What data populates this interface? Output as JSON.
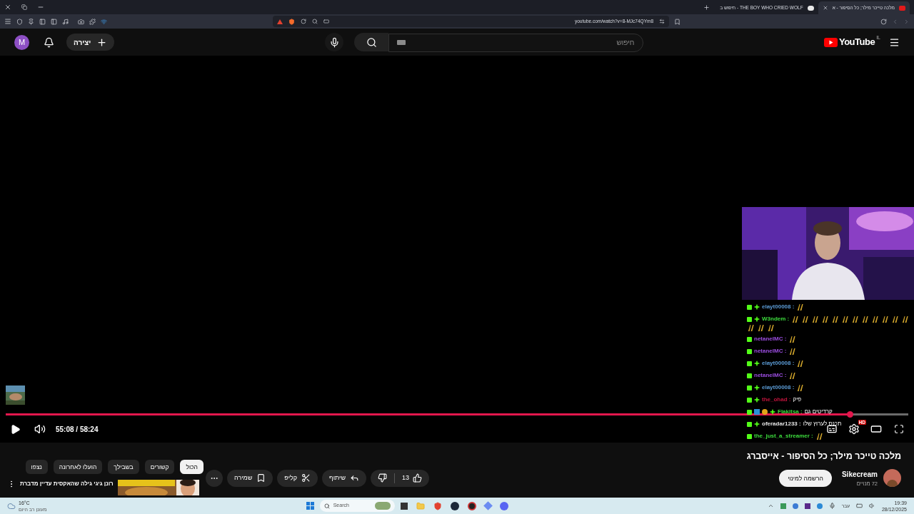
{
  "browser": {
    "tabs": [
      {
        "title": "מלכה טייכר מילר; כל הסיפור - א",
        "selected": true
      },
      {
        "title": "THE BOY WHO CRIED WOLF - חיפוש ב",
        "selected": false
      }
    ],
    "address": "youtube.com/watch?v=8-MJc74QYm8"
  },
  "header": {
    "avatar_letter": "M",
    "create_label": "יצירה",
    "search_placeholder": "חיפוש",
    "logo": "YouTube",
    "region": "IL"
  },
  "player": {
    "paused": true,
    "progress": {
      "level": 0.935
    },
    "time": "55:08 / 58:24",
    "settings_badge": "HD",
    "chat": [
      {
        "user": "elayt00008 :",
        "color": "#5b9bd5",
        "plus": true,
        "extra_badges": false,
        "parts": [
          {
            "kind": "emote"
          }
        ]
      },
      {
        "user": "W3ndem :",
        "color": "#3ddc3d",
        "plus": true,
        "extra_badges": false,
        "parts": [
          {
            "kind": "emote"
          },
          {
            "kind": "emote"
          },
          {
            "kind": "emote"
          },
          {
            "kind": "emote"
          },
          {
            "kind": "emote"
          },
          {
            "kind": "emote"
          },
          {
            "kind": "emote"
          },
          {
            "kind": "emote"
          },
          {
            "kind": "emote"
          },
          {
            "kind": "emote"
          },
          {
            "kind": "emote"
          },
          {
            "kind": "emote"
          },
          {
            "kind": "emote"
          },
          {
            "kind": "emote"
          },
          {
            "kind": "emote"
          }
        ]
      },
      {
        "user": "netanelMC :",
        "color": "#9b4de0",
        "plus": false,
        "extra_badges": false,
        "parts": [
          {
            "kind": "emote"
          }
        ]
      },
      {
        "user": "netanelMC :",
        "color": "#9b4de0",
        "plus": false,
        "extra_badges": false,
        "parts": [
          {
            "kind": "emote"
          }
        ]
      },
      {
        "user": "elayt00008 :",
        "color": "#5b9bd5",
        "plus": true,
        "extra_badges": false,
        "parts": [
          {
            "kind": "emote"
          }
        ]
      },
      {
        "user": "netanelMC :",
        "color": "#9b4de0",
        "plus": false,
        "extra_badges": false,
        "parts": [
          {
            "kind": "emote"
          }
        ]
      },
      {
        "user": "elayt00008 :",
        "color": "#5b9bd5",
        "plus": true,
        "extra_badges": false,
        "parts": [
          {
            "kind": "emote"
          }
        ]
      },
      {
        "user": "the_ohad :",
        "color": "#c0143c",
        "plus": true,
        "extra_badges": false,
        "parts": [
          {
            "kind": "text",
            "text": "פיק"
          }
        ]
      },
      {
        "user": "Flakitsa :",
        "color": "#3ddc3d",
        "plus": true,
        "extra_badges": true,
        "parts": [
          {
            "kind": "text",
            "text": "קרדיטים גם"
          }
        ]
      },
      {
        "user": "oferadar1233 :",
        "color": "#e6e6e6",
        "plus": true,
        "extra_badges": false,
        "parts": [
          {
            "kind": "text",
            "text": "תכנס לערוץ שלו"
          }
        ]
      },
      {
        "user": "the_just_a_streamer :",
        "color": "#3ddc3d",
        "plus": false,
        "extra_badges": false,
        "parts": [
          {
            "kind": "emote"
          }
        ]
      }
    ]
  },
  "video": {
    "title": "מלכה טייכר מילר; כל הסיפור - אייסברג",
    "channel": "Sikecream",
    "subscribers": "72 מנויים",
    "subscribe": "הרשמה למינוי",
    "likes": "13",
    "share": "שיתוף",
    "clip": "קליפ",
    "save": "שמירה"
  },
  "chips": [
    {
      "label": "הכול",
      "selected": true
    },
    {
      "label": "קשורים",
      "selected": false
    },
    {
      "label": "בשבילך",
      "selected": false
    },
    {
      "label": "הועלו לאחרונה",
      "selected": false
    },
    {
      "label": "נצפו",
      "selected": false
    }
  ],
  "recommended": {
    "title": "רונן גיגי גילה שהאקסית עדיין מדברת"
  },
  "taskbar": {
    "temperature": "16°C",
    "forecast": "מעונן רב היום",
    "search": "Search",
    "language": "עבר",
    "time": "19:39",
    "date": "28/12/2025"
  }
}
